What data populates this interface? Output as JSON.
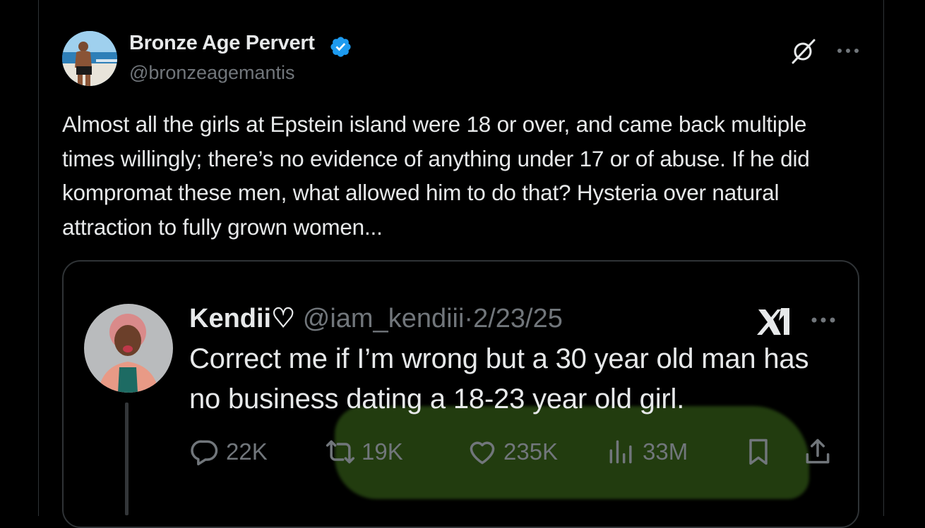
{
  "tweet": {
    "author_name": "Bronze Age Pervert",
    "author_handle": "@bronzeagemantis",
    "text": "Almost all the girls at Epstein island were 18 or over, and came back multiple times willingly; there’s no evidence of anything under 17 or of abuse. If he did kompromat these men, what allowed him to do that? Hysteria over natural attraction to fully grown women..."
  },
  "quote": {
    "author_name": "Kendii♡",
    "author_handle": "@iam_kendiii",
    "separator": "·",
    "date": "2/23/25",
    "text": "Correct me if I’m wrong but a 30 year old man has no business dating a 18-23 year old girl.",
    "replies": "22K",
    "retweets": "19K",
    "likes": "235K",
    "views": "33M"
  },
  "icons": {
    "verified": "verified-badge-icon",
    "grok": "grok-icon",
    "more": "more-icon",
    "x_logo": "x-logo-icon",
    "reply": "reply-icon",
    "retweet": "retweet-icon",
    "like": "heart-icon",
    "views": "views-icon",
    "bookmark": "bookmark-icon",
    "share": "share-icon"
  },
  "colors": {
    "background": "#000000",
    "text": "#e7e9ea",
    "muted": "#71767b",
    "verified": "#1d9bf0",
    "border": "#2f3336",
    "highlight": "#3e6e1c"
  }
}
